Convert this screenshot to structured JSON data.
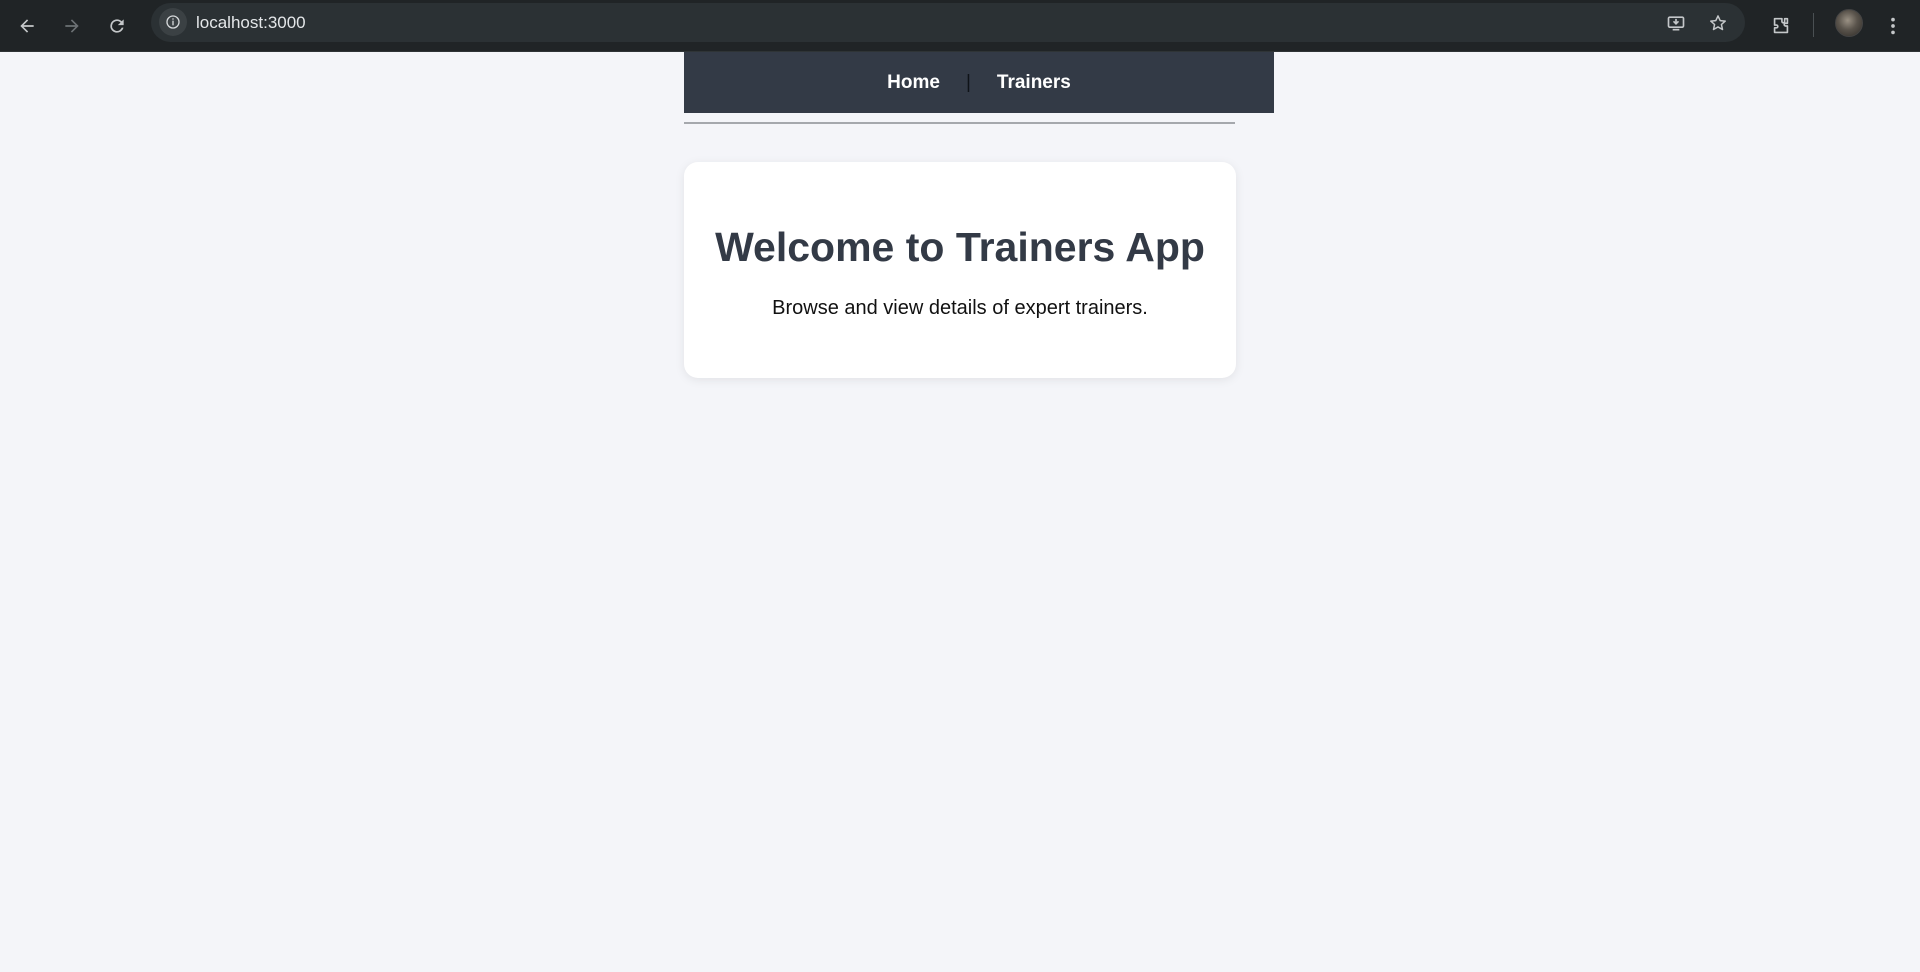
{
  "browser": {
    "url": "localhost:3000",
    "icons": [
      "back-arrow-icon",
      "forward-arrow-icon",
      "reload-icon",
      "site-info-icon",
      "install-app-icon",
      "bookmark-star-icon",
      "extensions-icon",
      "profile-avatar",
      "more-menu-icon"
    ]
  },
  "nav": {
    "home_label": "Home",
    "divider": "|",
    "trainers_label": "Trainers"
  },
  "hero": {
    "title": "Welcome to Trainers App",
    "subtitle": "Browse and view details of expert trainers."
  },
  "colors": {
    "page_bg": "#f4f5f9",
    "nav_bg": "#333a46",
    "title_color": "#333a46",
    "card_bg": "#ffffff",
    "browser_bar": "#202426"
  }
}
